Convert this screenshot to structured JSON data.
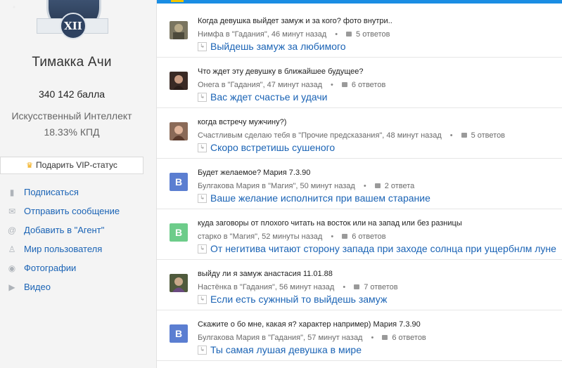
{
  "profile": {
    "badge_text": "XII",
    "name": "Тимакка Ачи",
    "points": "340 142 балла",
    "rank": "Искусственный Интеллект",
    "kpd": "18.33% КПД",
    "vip_label": "Подарить VIP-статус"
  },
  "menu": [
    {
      "label": "Подписаться",
      "icon": "bookmark-icon"
    },
    {
      "label": "Отправить сообщение",
      "icon": "mail-icon"
    },
    {
      "label": "Добавить в \"Агент\"",
      "icon": "at-icon"
    },
    {
      "label": "Мир пользователя",
      "icon": "user-icon"
    },
    {
      "label": "Фотографии",
      "icon": "camera-icon"
    },
    {
      "label": "Видео",
      "icon": "video-icon"
    }
  ],
  "questions": [
    {
      "title": "Когда девушка выйдет замуж и за кого? фото внутри..",
      "author": "Нимфа в \"Гадания\", 46 минут назад",
      "answers": "5 ответов",
      "answer": "Выйдешь замуж за любимого",
      "avatar": "photo"
    },
    {
      "title": "Что ждет эту девушку в ближайшее будущее?",
      "author": "Онега в \"Гадания\", 47 минут назад",
      "answers": "6 ответов",
      "answer": "Вас ждет счастье и удачи",
      "avatar": "photo"
    },
    {
      "title": "когда встречу мужчину?)",
      "author": "Счастливым сделаю тебя в \"Прочие предсказания\", 48 минут назад",
      "answers": "5 ответов",
      "answer": "Скоро встретишь сушеного",
      "avatar": "photo"
    },
    {
      "title": "Будет желаемое? Мария 7.3.90",
      "author": "Булгакова Мария в \"Магия\", 50 минут назад",
      "answers": "2 ответа",
      "answer": "Ваше желание исполнится при вашем старание",
      "avatar": "B"
    },
    {
      "title": "куда заговоры от плохого читать на восток или на запад или без разницы",
      "author": "старко в \"Магия\", 52 минуты назад",
      "answers": "6 ответов",
      "answer": "От негитива читают сторону запада при заходе солнца при ущербнлм луне",
      "avatar": "B"
    },
    {
      "title": "выйду ли я замуж анастасия 11.01.88",
      "author": "Настёнка в \"Гадания\", 56 минут назад",
      "answers": "7 ответов",
      "answer": "Если есть сужнный то выйдешь замуж",
      "avatar": "photo"
    },
    {
      "title": "Скажите о бо мне, какая я? характер например) Мария 7.3.90",
      "author": "Булгакова Мария в \"Гадания\", 57 минут назад",
      "answers": "6 ответов",
      "answer": "Ты самая лушая девушка в мире",
      "avatar": "B"
    }
  ],
  "colors": {
    "link": "#1a63b5",
    "top_bar": "#1a8de3",
    "avatar_blue": "#5b7ed1",
    "avatar_green": "#6dcc8a",
    "crown": "#f0a400"
  }
}
